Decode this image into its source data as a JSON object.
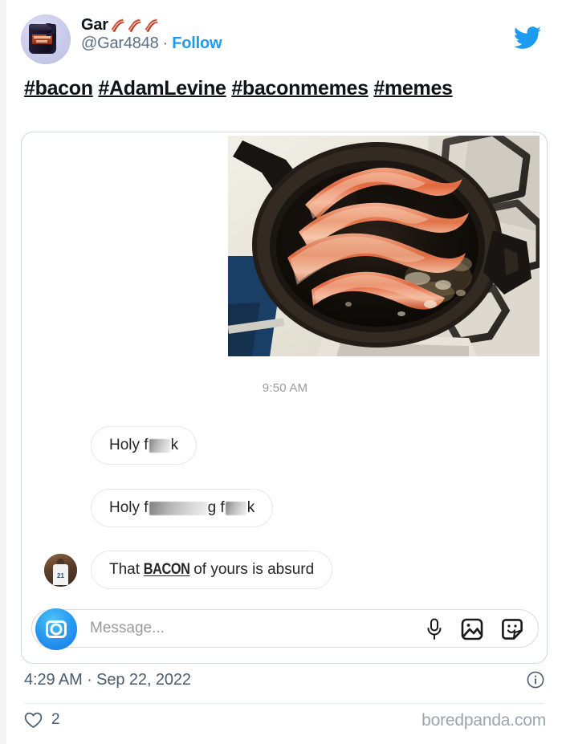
{
  "platform": "twitter",
  "colors": {
    "accent_blue": "#1d9bf0",
    "text_primary": "#0f1419",
    "text_secondary": "#5b7083",
    "footer_text": "#4a5c6d",
    "watermark": "#9aa5ad",
    "card_border": "#cfd9de",
    "ig_camera_blue": "#1877e8"
  },
  "header": {
    "display_name": "Gar",
    "name_emojis": [
      "bacon",
      "bacon",
      "bacon"
    ],
    "handle": "@Gar4848",
    "separator": "·",
    "follow_label": "Follow",
    "avatar_alt": "bacon-club-coffee-mug",
    "brand_icon": "twitter-bird-icon"
  },
  "tweet": {
    "hashtags": [
      "#bacon",
      "#AdamLevine",
      "#baconmemes",
      "#memes"
    ],
    "timestamp": "4:29 AM · Sep 22, 2022",
    "info_icon": "info-circle-icon",
    "like_icon": "heart-icon",
    "like_count": "2",
    "watermark": "boredpanda.com"
  },
  "dm_screenshot": {
    "photo_alt": "bacon-frying-in-cast-iron-skillet-on-gas-stove",
    "message_time": "9:50 AM",
    "messages": [
      {
        "id": "msg-1",
        "parts": [
          {
            "type": "text",
            "value": "Holy f"
          },
          {
            "type": "censor",
            "size": "sm"
          },
          {
            "type": "text",
            "value": "k"
          }
        ]
      },
      {
        "id": "msg-2",
        "parts": [
          {
            "type": "text",
            "value": "Holy f"
          },
          {
            "type": "censor",
            "size": "lg"
          },
          {
            "type": "text",
            "value": "g f"
          },
          {
            "type": "censor",
            "size": "sm"
          },
          {
            "type": "text",
            "value": "k"
          }
        ]
      },
      {
        "id": "msg-3",
        "prefix": "That ",
        "emphasis": "BACON",
        "suffix": " of yours is absurd",
        "avatar_alt": "basketball-jersey-21-avatar"
      }
    ],
    "input_bar": {
      "camera_icon": "camera-icon",
      "placeholder": "Message...",
      "icons": [
        "microphone-icon",
        "photo-gallery-icon",
        "sticker-icon"
      ]
    }
  }
}
